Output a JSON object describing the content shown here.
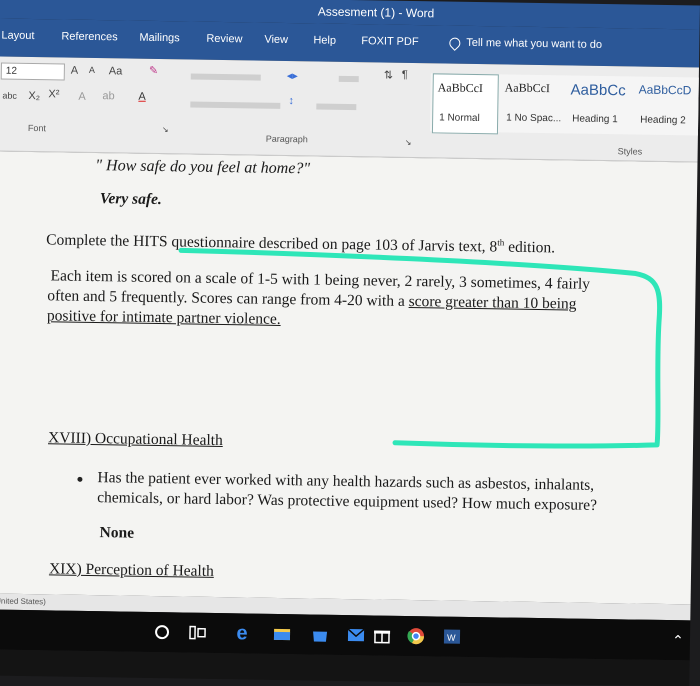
{
  "window": {
    "title": "Assesment (1)  -  Word"
  },
  "tabs": [
    "Layout",
    "References",
    "Mailings",
    "Review",
    "View",
    "Help",
    "FOXIT PDF"
  ],
  "tell_me": "Tell me what you want to do",
  "ribbon": {
    "font_size": "12",
    "font_group_label": "Font",
    "paragraph_group_label": "Paragraph",
    "styles_group_label": "Styles",
    "styles": [
      {
        "sample": "AaBbCcI",
        "name": "1 Normal"
      },
      {
        "sample": "AaBbCcI",
        "name": "1 No Spac..."
      },
      {
        "sample": "AaBbCc",
        "name": "Heading 1"
      },
      {
        "sample": "AaBbCcD",
        "name": "Heading 2"
      }
    ]
  },
  "document": {
    "question": "\" How safe do you feel at home?\"",
    "answer": "Very safe.",
    "complete_prefix": "Complete the HITS questionnaire described on page 103 of Jarvis text, 8",
    "complete_sup": "th",
    "complete_suffix": " edition.",
    "para_line1": "Each item is scored on a scale of 1-5 with 1 being never, 2 rarely, 3 sometimes, 4 fairly",
    "para_line2_a": "often and 5 frequently.  Scores can range from 4-20 with a ",
    "para_line2_b": "score greater than 10 being",
    "para_line3": "positive for intimate partner violence.",
    "section18": "XVIII) Occupational Health",
    "hazard_line1": "Has the patient ever worked with any health hazards such as asbestos, inhalants,",
    "hazard_line2": "chemicals, or hard labor? Was protective equipment used? How much exposure?",
    "hazard_answer": "None",
    "section19": "XIX) Perception of Health"
  },
  "status_bar": {
    "language": "(United States)"
  },
  "annotation_color": "#2ee6b8",
  "accent": "#2b5797"
}
